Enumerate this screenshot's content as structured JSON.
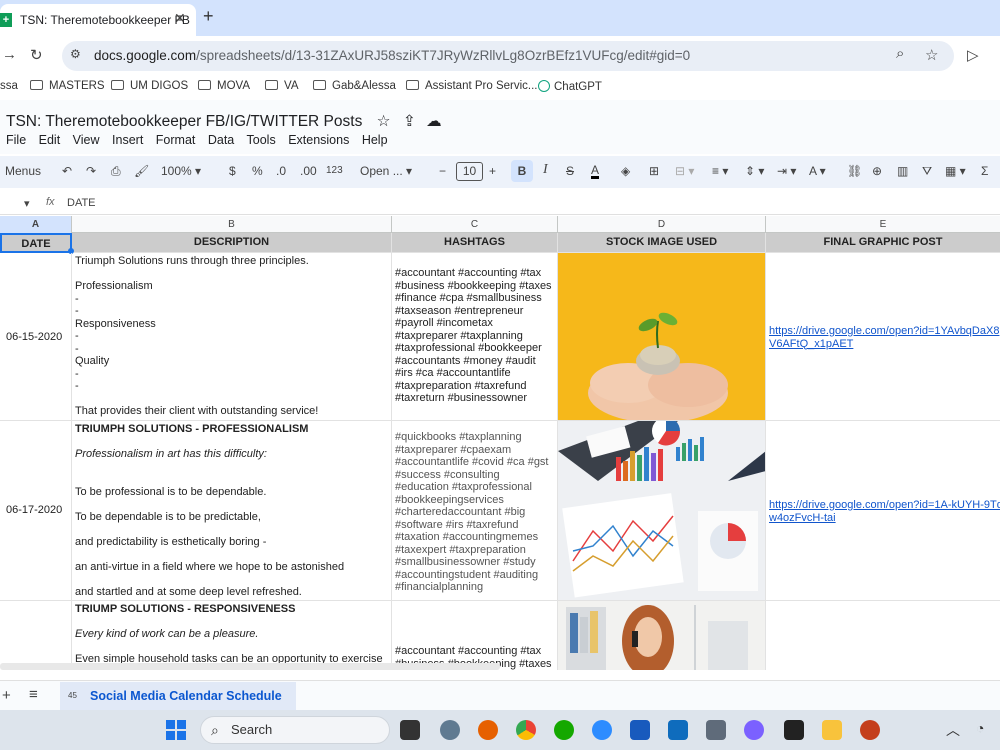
{
  "browser": {
    "tab_title": "TSN: Theremotebookkeeper FB",
    "tab_favicon": "+",
    "url_domain": "docs.google.com",
    "url_path": "/spreadsheets/d/13-31ZAxURJ58sziKT7JRyWzRllvLg8OzrBEfz1VUFcg/edit#gid=0",
    "bookmarks": [
      "ssa",
      "MASTERS",
      "UM DIGOS",
      "MOVA",
      "VA",
      "Gab&Alessa",
      "Assistant Pro Servic...",
      "ChatGPT"
    ]
  },
  "sheet": {
    "title": "TSN: Theremotebookkeeper FB/IG/TWITTER Posts",
    "menu": [
      "File",
      "Edit",
      "View",
      "Insert",
      "Format",
      "Data",
      "Tools",
      "Extensions",
      "Help"
    ],
    "toolbar": {
      "menus_label": "Menus",
      "zoom": "100%",
      "currency": "$",
      "percent": "%",
      "dec_decrease": ".0",
      "dec_increase": ".00",
      "number_format": "123",
      "font": "Open ...",
      "font_size": "10",
      "bold": "B",
      "italic": "I"
    },
    "formula_bar": {
      "fx": "fx",
      "value": "DATE"
    },
    "columns": [
      "A",
      "B",
      "C",
      "D",
      "E"
    ],
    "headers": [
      "DATE",
      "DESCRIPTION",
      "HASHTAGS",
      "STOCK IMAGE USED",
      "FINAL GRAPHIC POST"
    ],
    "rows": [
      {
        "date": "06-15-2020",
        "description": [
          "Triumph Solutions runs through three principles.",
          "",
          "Professionalism",
          "-",
          "-",
          "Responsiveness",
          "-",
          "-",
          "Quality",
          "-",
          "-",
          "",
          "That provides their client with outstanding service!"
        ],
        "hashtags": "#accountant #accounting #tax #business #bookkeeping #taxes #finance #cpa #smallbusiness #taxseason #entrepreneur #payroll #incometax #taxpreparer #taxplanning #taxprofessional #bookkeeper #accountants #money #audit #irs #ca #accountantlife #taxpreparation #taxrefund #taxreturn #businessowner",
        "link": [
          "https://drive.google.com/open?id=1YAvbqDaX8",
          "V6AFtQ_x1pAET"
        ]
      },
      {
        "date": "06-17-2020",
        "title": "TRIUMPH SOLUTIONS - PROFESSIONALISM",
        "description": [
          "Professionalism in art has this difficulty:",
          "",
          "",
          "To be professional is to be dependable.",
          "",
          "To be dependable is to be predictable,",
          "",
          "and predictability is esthetically boring -",
          "",
          "an anti-virtue in a field where we hope to be astonished",
          "",
          "and startled and at some deep level refreshed."
        ],
        "hashtags": "#quickbooks #taxplanning #taxpreparer #cpaexam #accountantlife #covid #ca #gst #success #consulting #education #taxprofessional #bookkeepingservices #charteredaccountant #big #software #irs #taxrefund #taxation #accountingmemes #taxexpert #taxpreparation #smallbusinessowner #study #accountingstudent #auditing #financialplanning",
        "link": [
          "https://drive.google.com/open?id=1A-kUYH-9Tq",
          "w4ozFvcH-tai"
        ]
      },
      {
        "title": "TRIUMP SOLUTIONS - RESPONSIVENESS",
        "description": [
          "Every kind of work can be a pleasure.",
          "",
          "Even simple household tasks can be an opportunity to exercise"
        ],
        "hashtags": "#accountant #accounting #tax #business #bookkeeping #taxes"
      }
    ],
    "sheet_tab": {
      "count": "45",
      "name": "Social Media Calendar Schedule"
    }
  },
  "taskbar": {
    "search_placeholder": "Search"
  }
}
